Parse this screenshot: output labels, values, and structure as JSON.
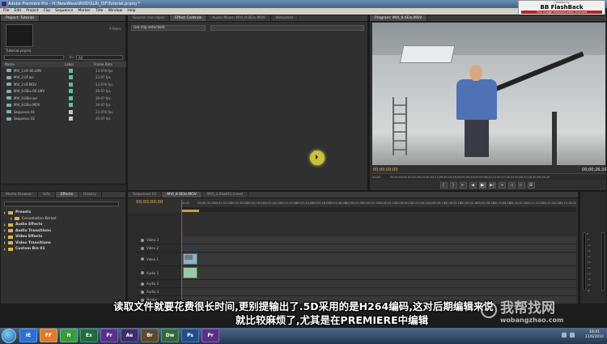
{
  "window": {
    "title": "Adobe Premiere Pro - H:\\NewWave\\RVID\\SLR\\_ISF\\Tutorial.prproj *"
  },
  "watermark_box": {
    "line1": "Created by",
    "brand": "BB FlashBack",
    "line3": "This image removed when licensed"
  },
  "menu": [
    "File",
    "Edit",
    "Project",
    "Clip",
    "Sequence",
    "Marker",
    "Title",
    "Window",
    "Help"
  ],
  "project_panel": {
    "tab": "Project: Tutorial",
    "file": "Tutorial.prproj",
    "item_count": "9 Items",
    "in_label": "In:",
    "in_value": "All",
    "columns": [
      "Name",
      "Label",
      "Frame Rate"
    ],
    "items": [
      {
        "name": "MVI_2.0F-00.LMV",
        "fps": "23.976 fps",
        "color": "#5fbfa0"
      },
      {
        "name": "MVI_2.0F.avi",
        "fps": "23.97 fps",
        "color": "#5fbfa0"
      },
      {
        "name": "MVI_2.0F.MOV",
        "fps": "23.976 fps",
        "color": "#5fbfa0"
      },
      {
        "name": "MVI_9.0Ele-00.LMV",
        "fps": "29.97 fps",
        "color": "#5fbfa0"
      },
      {
        "name": "MVI_9.0Ele.avi",
        "fps": "29.97 fps",
        "color": "#5fbfa0"
      },
      {
        "name": "MVI_9.0Ele.MOV",
        "fps": "29.97 fps",
        "color": "#5fbfa0"
      },
      {
        "name": "Sequence 01",
        "fps": "23.976 fps",
        "color": "#c8c8c8"
      },
      {
        "name": "Sequence 02",
        "fps": "29.97 fps",
        "color": "#c8c8c8"
      }
    ]
  },
  "source_panel": {
    "tabs": [
      "Source: (no clips)",
      "Effect Controls",
      "Audio Mixer: MVI_9.0Ele.MOV",
      "Metadata"
    ],
    "no_clip": "(no clip selected)"
  },
  "program_panel": {
    "tab": "Program: MVI_9.0Ele.MOV",
    "timecode_in": "00;00;00;00",
    "timecode_out": "00;00;26;20",
    "ruler": [
      "00;00",
      "00;01;04;02",
      "00;02;08;04",
      "00;03;12;06",
      "00;04;16;08",
      "00;05;20;10",
      "00;06;24;12",
      "00;07;28;14",
      "00;08;32;16",
      "00;09;36;18"
    ],
    "transport": [
      "{",
      "}",
      "⇤",
      "◀",
      "▶",
      "▶|",
      "⇥",
      "◁",
      "▷",
      "⊞"
    ]
  },
  "effects_panel": {
    "tabs": [
      "Media Browser",
      "Info",
      "Effects",
      "History"
    ],
    "items": [
      {
        "label": "Presets",
        "sub": false
      },
      {
        "label": "Convolution Kernel",
        "sub": true
      },
      {
        "label": "Audio Effects",
        "sub": false
      },
      {
        "label": "Audio Transitions",
        "sub": false
      },
      {
        "label": "Video Effects",
        "sub": false
      },
      {
        "label": "Video Transitions",
        "sub": false
      },
      {
        "label": "Custom Bin 01",
        "sub": false
      }
    ]
  },
  "timeline": {
    "tabs": [
      "Sequence 01",
      "MVI_9.0Ele.MOV",
      "MVI_2.0Sel03.Lnent"
    ],
    "timecode": "00;00;00;00",
    "ruler": [
      "00;00",
      "00;00;32;00",
      "00;01;04;02",
      "00;01;36;02",
      "00;02;08;04",
      "00;02;40;04",
      "00;03;12;06",
      "00;03;44;06",
      "00;04;16;08",
      "00;04;48;08",
      "00;05;20;10",
      "00;05;52;10",
      "00;06;24;12",
      "00;06;56;12",
      "00;07;28;14",
      "00;08;00;14",
      "00;08;32;16",
      "00;09;04;16",
      "00;09;36;18",
      "00;10;08;18",
      "00;10;40;20",
      "00;11;12;20",
      "00;11;44;22",
      "00;12;16;22"
    ],
    "tracks": [
      {
        "label": "Video 3",
        "kind": "video"
      },
      {
        "label": "Video 2",
        "kind": "video"
      },
      {
        "label": "Video 1",
        "kind": "video1",
        "clip": "MVI_9.0Ele"
      },
      {
        "label": "Audio 1",
        "kind": "audio1"
      },
      {
        "label": "Audio 2",
        "kind": "audio"
      },
      {
        "label": "Audio 3",
        "kind": "audio"
      },
      {
        "label": "Master",
        "kind": "audio"
      }
    ]
  },
  "meters": {
    "tab": "Audio Master Meters",
    "db": [
      "0",
      "-6",
      "-12",
      "-18",
      "-24",
      "-30",
      "-36",
      "-42",
      "-48",
      "-54",
      "dB"
    ]
  },
  "subtitles": {
    "line1": "读取文件就要花费很长时间,更别提输出了.5D采用的是H264编码,这对后期编辑来说",
    "line2": "就比较麻烦了,尤其是在PREMIERE中编辑"
  },
  "site_watermark": {
    "cn": "我帮找网",
    "url": "wobangzhao.com"
  },
  "taskbar": {
    "apps": [
      "IE",
      "FF",
      "H",
      "Ex",
      "Pr",
      "Ae",
      "Br",
      "Dw",
      "Ps",
      "Pr"
    ],
    "time": "16:41",
    "date": "11/6/2010"
  }
}
